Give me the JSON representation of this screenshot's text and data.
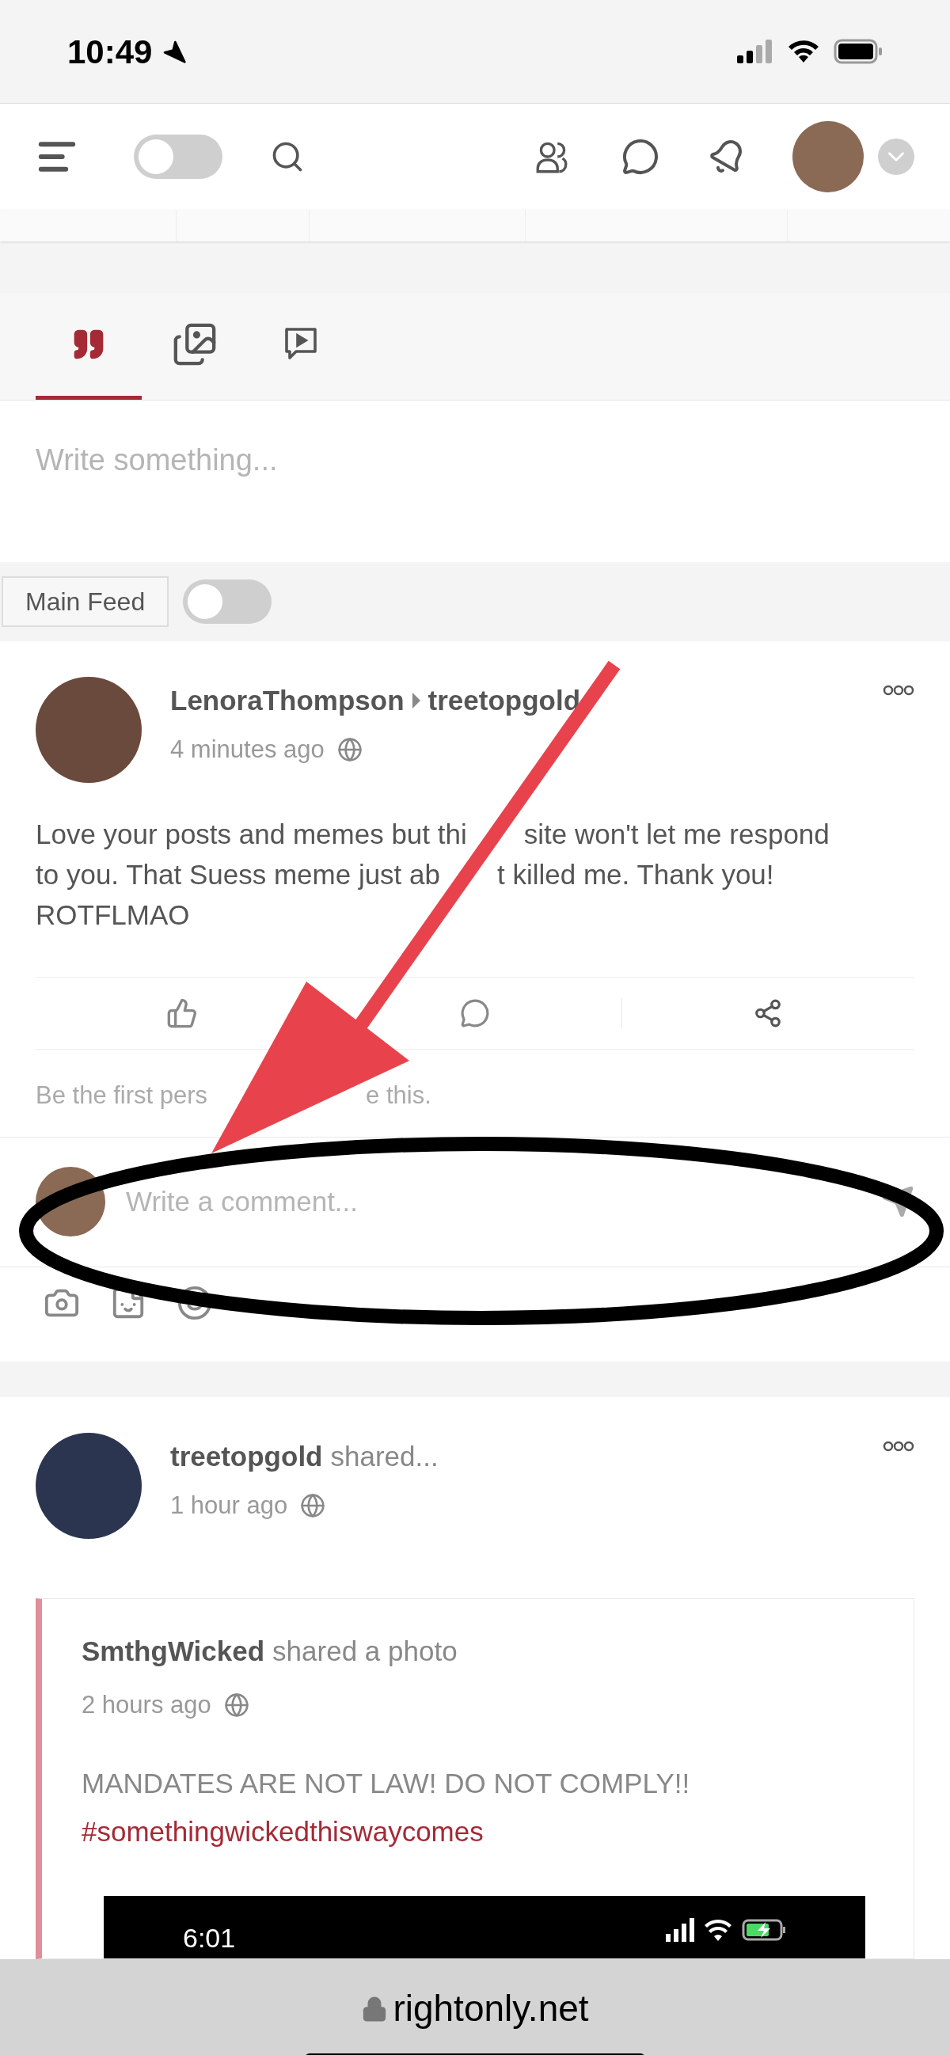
{
  "status_bar": {
    "time": "10:49"
  },
  "header": {
    "theme_toggle": {
      "on": false
    }
  },
  "composer": {
    "tabs": [
      {
        "kind": "text",
        "selected": true
      },
      {
        "kind": "photo",
        "selected": false
      },
      {
        "kind": "video",
        "selected": false
      }
    ],
    "placeholder": "Write something..."
  },
  "feed_filter": {
    "label": "Main Feed",
    "toggle": {
      "on": false
    }
  },
  "post": {
    "author": "LenoraThompson",
    "target": "treetopgold",
    "time": "4 minutes ago",
    "body_lines": [
      [
        "Love your posts and memes but thi",
        "site won't let me respond"
      ],
      [
        "to you. That Suess meme just ab",
        "t killed me. Thank you!"
      ],
      [
        "ROTFLMAO"
      ]
    ],
    "likes_text": [
      "Be the first pers",
      "e this."
    ],
    "comment_placeholder": "Write a comment..."
  },
  "shared_post": {
    "author": "treetopgold",
    "action": "shared...",
    "time": "1 hour ago",
    "original": {
      "author": "SmthgWicked",
      "action": "shared a photo",
      "time": "2 hours ago",
      "text": "MANDATES ARE NOT LAW! DO NOT COMPLY!!",
      "hashtag": "#somethingwickedthiswaycomes",
      "screenshot_time": "6:01"
    }
  },
  "browser_bar": {
    "url": "rightonly.net"
  }
}
